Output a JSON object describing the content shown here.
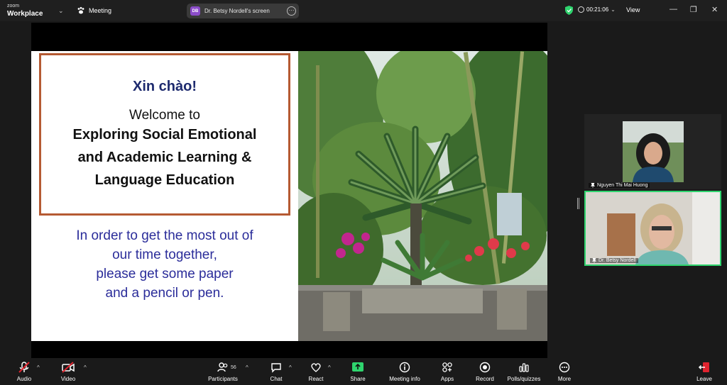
{
  "app": {
    "logo_line1": "zoom",
    "logo_line2": "Workplace",
    "meeting_label": "Meeting"
  },
  "share_pill": {
    "badge": "DB",
    "text": "Dr. Betsy Nordell's screen"
  },
  "status": {
    "timer": "00:21:06",
    "view_label": "View"
  },
  "slide": {
    "greeting": "Xin chào!",
    "welcome": "Welcome to",
    "title_lines": [
      "Exploring  Social Emotional",
      "and Academic Learning  &",
      "Language Education"
    ],
    "message_lines": [
      "In order to get the most out of",
      "our time together,",
      "please get some paper",
      "and a pencil or pen."
    ]
  },
  "participants": [
    {
      "name": "Nguyen Thi Mai Huong"
    },
    {
      "name": "Dr. Betsy Nordell"
    }
  ],
  "toolbar": {
    "audio": "Audio",
    "video": "Video",
    "participants": "Participants",
    "participants_count": "56",
    "chat": "Chat",
    "react": "React",
    "share": "Share",
    "meeting_info": "Meeting info",
    "apps": "Apps",
    "record": "Record",
    "polls": "Polls/quizzes",
    "more": "More",
    "leave": "Leave"
  },
  "colors": {
    "share_green": "#2fd46e",
    "leave_red": "#e0242f",
    "slide_blue": "#2b2d9a",
    "frame_border": "#b55a32"
  }
}
